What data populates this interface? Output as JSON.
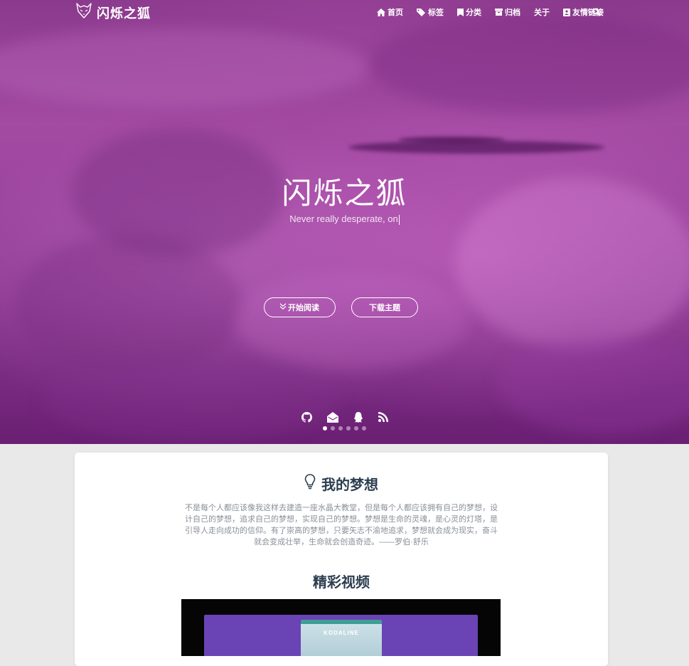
{
  "brand": {
    "name": "闪烁之狐"
  },
  "nav": {
    "items": [
      {
        "label": "首页",
        "icon": "home-icon"
      },
      {
        "label": "标签",
        "icon": "tags-icon"
      },
      {
        "label": "分类",
        "icon": "bookmark-icon"
      },
      {
        "label": "归档",
        "icon": "archive-icon"
      },
      {
        "label": "关于",
        "icon": ""
      },
      {
        "label": "友情链接",
        "icon": "address-book-icon"
      }
    ],
    "search_icon": "search-icon"
  },
  "hero": {
    "title": "闪烁之狐",
    "subtitle": "Never really desperate, on",
    "read_button": "开始阅读",
    "download_button": "下载主题",
    "social_icons": [
      "github-icon",
      "envelope-icon",
      "qq-icon",
      "rss-icon"
    ],
    "active_slide": 1,
    "slide_count": 6
  },
  "dream": {
    "title": "我的梦想",
    "text": "不是每个人都应该像我这样去建造一座水晶大教堂，但是每个人都应该拥有自己的梦想，设计自己的梦想，追求自己的梦想，实现自己的梦想。梦想是生命的灵魂，是心灵的灯塔，是引导人走向成功的信仰。有了崇高的梦想，只要矢志不渝地追求，梦想就会成为现实，奋斗就会变成壮举，生命就会创造奇迹。——罗伯·舒乐"
  },
  "video": {
    "title": "精彩视频",
    "thumb_title": "KODALINE"
  },
  "colors": {
    "accent": "#6a43b4",
    "heading": "#2c3e50",
    "hero_top": "#8a3a8c",
    "hero_bottom": "#6a1f73"
  }
}
